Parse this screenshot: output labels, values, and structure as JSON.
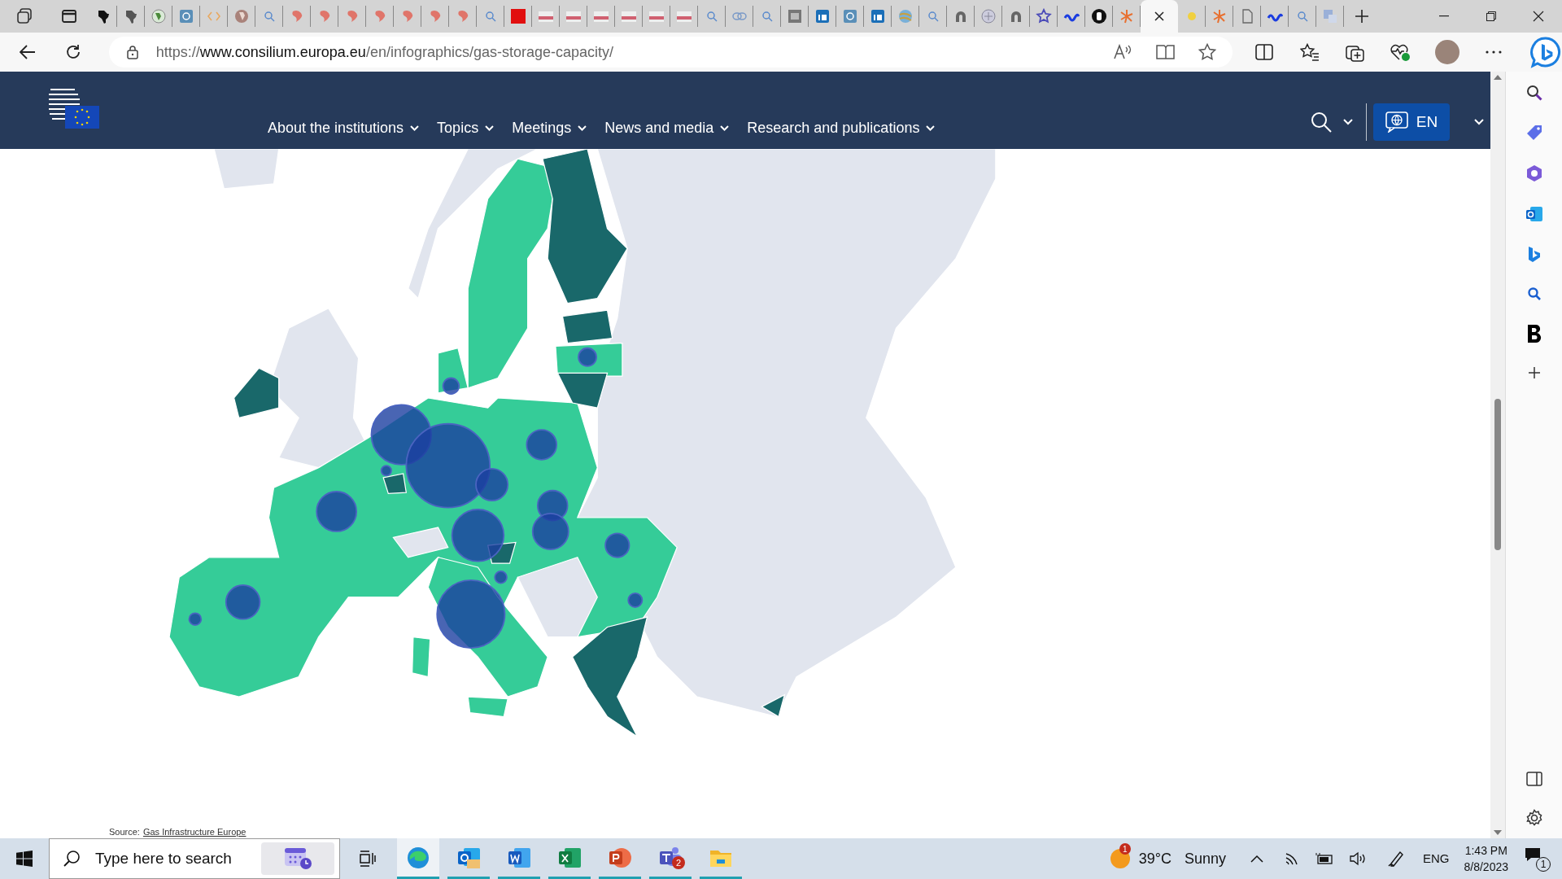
{
  "browser": {
    "tabs": [
      {
        "kind": "africa",
        "selected": false
      },
      {
        "kind": "africa-gray",
        "selected": false
      },
      {
        "kind": "globe",
        "selected": false
      },
      {
        "kind": "tile",
        "selected": false
      },
      {
        "kind": "code",
        "selected": false
      },
      {
        "kind": "globe-brown",
        "selected": false
      },
      {
        "kind": "search",
        "selected": false
      },
      {
        "kind": "pin",
        "selected": false
      },
      {
        "kind": "pin",
        "selected": false
      },
      {
        "kind": "pin",
        "selected": false
      },
      {
        "kind": "pin",
        "selected": false
      },
      {
        "kind": "pin",
        "selected": false
      },
      {
        "kind": "pin",
        "selected": false
      },
      {
        "kind": "pin",
        "selected": false
      },
      {
        "kind": "search",
        "selected": false
      },
      {
        "kind": "red",
        "selected": false
      },
      {
        "kind": "bars",
        "selected": false
      },
      {
        "kind": "bars",
        "selected": false
      },
      {
        "kind": "bars",
        "selected": false
      },
      {
        "kind": "bars",
        "selected": false
      },
      {
        "kind": "bars",
        "selected": false
      },
      {
        "kind": "bars",
        "selected": false
      },
      {
        "kind": "search",
        "selected": false
      },
      {
        "kind": "link",
        "selected": false
      },
      {
        "kind": "search",
        "selected": false
      },
      {
        "kind": "gray-tile",
        "selected": false
      },
      {
        "kind": "blue-tile",
        "selected": false
      },
      {
        "kind": "tile",
        "selected": false
      },
      {
        "kind": "blue-tile",
        "selected": false
      },
      {
        "kind": "ball",
        "selected": false
      },
      {
        "kind": "search",
        "selected": false
      },
      {
        "kind": "arc",
        "selected": false
      },
      {
        "kind": "emblem",
        "selected": false
      },
      {
        "kind": "arc",
        "selected": false
      },
      {
        "kind": "star",
        "selected": false
      },
      {
        "kind": "wave",
        "selected": false
      },
      {
        "kind": "dark-circle",
        "selected": false
      },
      {
        "kind": "sunburst",
        "selected": false
      },
      {
        "selected": true
      },
      {
        "kind": "sun",
        "selected": false
      },
      {
        "kind": "sunburst",
        "selected": false
      },
      {
        "kind": "doc",
        "selected": false
      },
      {
        "kind": "wave",
        "selected": false
      },
      {
        "kind": "search",
        "selected": false
      },
      {
        "kind": "translate",
        "selected": false
      }
    ],
    "address_bar": {
      "scheme": "https://",
      "domain": "www.consilium.europa.eu",
      "path": "/en/infographics/gas-storage-capacity/"
    }
  },
  "site": {
    "nav": [
      {
        "label": "About the institutions"
      },
      {
        "label": "Topics"
      },
      {
        "label": "Meetings"
      },
      {
        "label": "News and media"
      },
      {
        "label": "Research and publications"
      }
    ],
    "language": "EN",
    "source": {
      "label": "Source:",
      "link": "Gas Infrastructure Europe"
    }
  },
  "taskbar": {
    "search": {
      "placeholder": "Type here to search"
    },
    "apps": [
      {
        "kind": "edge",
        "selected": true
      },
      {
        "kind": "outlook",
        "selected": false
      },
      {
        "kind": "word",
        "selected": false
      },
      {
        "kind": "excel",
        "selected": false
      },
      {
        "kind": "powerpoint",
        "selected": false
      },
      {
        "kind": "teams",
        "selected": false,
        "badge": "2"
      },
      {
        "kind": "explorer",
        "selected": false
      }
    ],
    "weather": {
      "badge": "1",
      "temperature": "39°C",
      "condition": "Sunny"
    },
    "language": "ENG",
    "time": "1:43 PM",
    "date": "8/8/2023",
    "notifications": "1"
  }
}
